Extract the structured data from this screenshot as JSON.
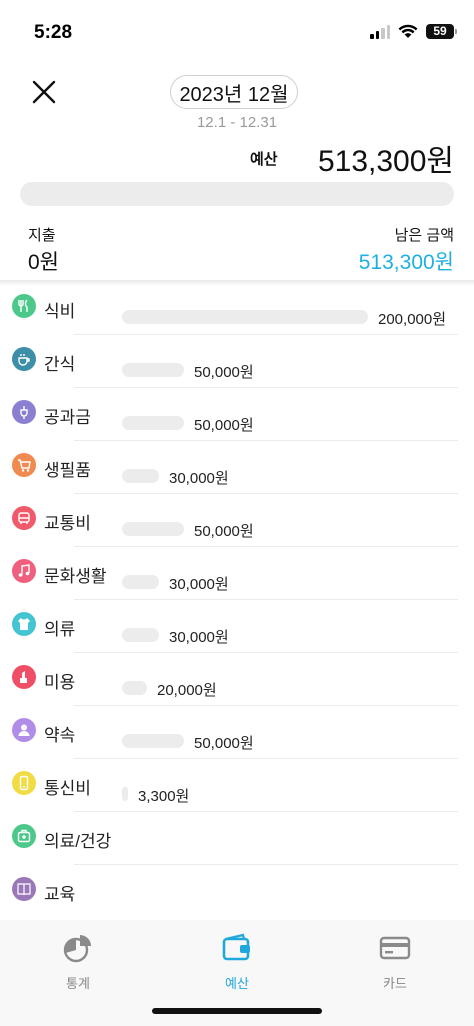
{
  "status_bar": {
    "time": "5:28",
    "battery": "59"
  },
  "header": {
    "month": "2023년 12월",
    "date_range": "12.1 - 12.31"
  },
  "budget": {
    "label": "예산",
    "amount": "513,300원",
    "used_fraction": 0
  },
  "summary": {
    "spend_label": "지출",
    "spend_amount": "0원",
    "remain_label": "남은 금액",
    "remain_amount": "513,300원"
  },
  "colors": {
    "accent": "#20b3df",
    "remain": "#1eb0e0",
    "bar_track": "#ececec"
  },
  "categories": [
    {
      "name": "식비",
      "amount": "200,000원",
      "value": 200000,
      "color": "#4cc98a",
      "icon": "utensils-icon"
    },
    {
      "name": "간식",
      "amount": "50,000원",
      "value": 50000,
      "color": "#3d8fa8",
      "icon": "coffee-icon"
    },
    {
      "name": "공과금",
      "amount": "50,000원",
      "value": 50000,
      "color": "#8a7fd0",
      "icon": "plug-icon"
    },
    {
      "name": "생필품",
      "amount": "30,000원",
      "value": 30000,
      "color": "#f08a50",
      "icon": "cart-icon"
    },
    {
      "name": "교통비",
      "amount": "50,000원",
      "value": 50000,
      "color": "#f05a6a",
      "icon": "bus-icon"
    },
    {
      "name": "문화생활",
      "amount": "30,000원",
      "value": 30000,
      "color": "#f0607e",
      "icon": "music-icon"
    },
    {
      "name": "의류",
      "amount": "30,000원",
      "value": 30000,
      "color": "#45c4d2",
      "icon": "shirt-icon"
    },
    {
      "name": "미용",
      "amount": "20,000원",
      "value": 20000,
      "color": "#f04e66",
      "icon": "lipstick-icon"
    },
    {
      "name": "약속",
      "amount": "50,000원",
      "value": 50000,
      "color": "#b08ee8",
      "icon": "person-icon"
    },
    {
      "name": "통신비",
      "amount": "3,300원",
      "value": 3300,
      "color": "#f2dc45",
      "icon": "phone-icon"
    },
    {
      "name": "의료/건강",
      "amount": "",
      "value": 0,
      "color": "#4cc98a",
      "icon": "medical-kit-icon"
    },
    {
      "name": "교육",
      "amount": "",
      "value": 0,
      "color": "#9a78b8",
      "icon": "book-icon"
    }
  ],
  "tabs": [
    {
      "label": "통계",
      "icon": "pie-chart-icon",
      "active": false
    },
    {
      "label": "예산",
      "icon": "wallet-icon",
      "active": true
    },
    {
      "label": "카드",
      "icon": "credit-card-icon",
      "active": false
    }
  ]
}
